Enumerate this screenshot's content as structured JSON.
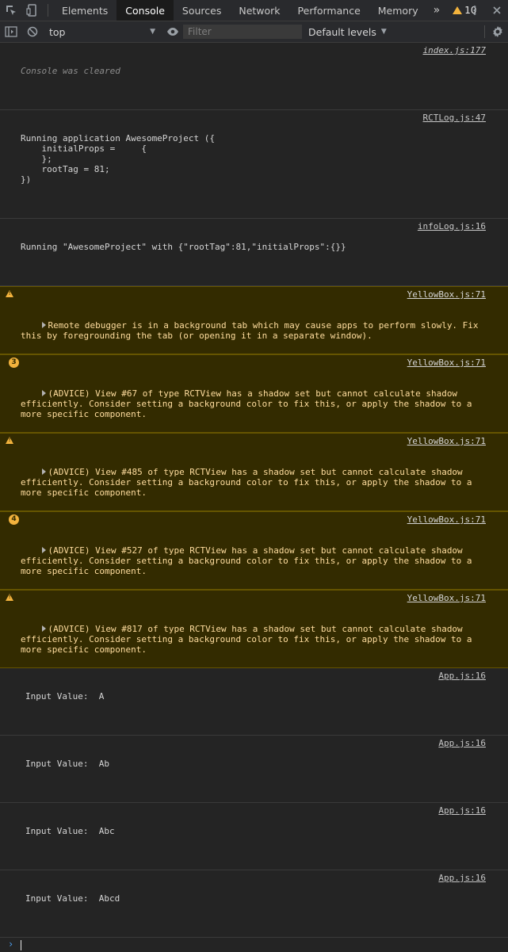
{
  "tabbar": {
    "tabs": [
      "Elements",
      "Console",
      "Sources",
      "Network",
      "Performance",
      "Memory"
    ],
    "active_tab": "Console",
    "more": "»",
    "warning_count": "10"
  },
  "toolbar": {
    "context": "top",
    "filter_placeholder": "Filter",
    "levels": "Default levels"
  },
  "messages": {
    "cleared": {
      "text": "Console was cleared",
      "source": "index.js:177"
    },
    "running_app": {
      "text": "Running application AwesomeProject ({\n    initialProps =     {\n    };\n    rootTag = 81;\n})",
      "source": "RCTLog.js:47"
    },
    "running_info": {
      "text": "Running \"AwesomeProject\" with {\"rootTag\":81,\"initialProps\":{}}",
      "source": "infoLog.js:16"
    },
    "warn_debugger": {
      "text": "Remote debugger is in a background tab which may cause apps to perform slowly. Fix this by foregrounding the tab (or opening it in a separate window).",
      "source": "YellowBox.js:71"
    },
    "advice_67": {
      "badge": "3",
      "text": "(ADVICE) View #67 of type RCTView has a shadow set but cannot calculate shadow efficiently. Consider setting a background color to fix this, or apply the shadow to a more specific component.",
      "source": "YellowBox.js:71"
    },
    "advice_485": {
      "text": "(ADVICE) View #485 of type RCTView has a shadow set but cannot calculate shadow efficiently. Consider setting a background color to fix this, or apply the shadow to a more specific component.",
      "source": "YellowBox.js:71"
    },
    "advice_527": {
      "badge": "4",
      "text": "(ADVICE) View #527 of type RCTView has a shadow set but cannot calculate shadow efficiently. Consider setting a background color to fix this, or apply the shadow to a more specific component.",
      "source": "YellowBox.js:71"
    },
    "advice_817": {
      "text": "(ADVICE) View #817 of type RCTView has a shadow set but cannot calculate shadow efficiently. Consider setting a background color to fix this, or apply the shadow to a more specific component.",
      "source": "YellowBox.js:71"
    },
    "input_values": [
      {
        "text": "Input Value:  A",
        "source": "App.js:16"
      },
      {
        "text": "Input Value:  Ab",
        "source": "App.js:16"
      },
      {
        "text": "Input Value:  Abc",
        "source": "App.js:16"
      },
      {
        "text": "Input Value:  Abcd",
        "source": "App.js:16"
      }
    ]
  },
  "prompt": {
    "chevron": "›"
  },
  "colors": {
    "background": "#242424",
    "warning_bg": "#332b00",
    "warning_text": "#ffdd9e",
    "warning_icon": "#f3b33d",
    "prompt": "#4d9fef"
  },
  "icons": [
    "inspect-element-icon",
    "device-toolbar-icon",
    "warning-icon",
    "kebab-menu-icon",
    "close-icon",
    "sidebar-toggle-icon",
    "clear-console-icon",
    "eye-icon",
    "gear-icon"
  ]
}
